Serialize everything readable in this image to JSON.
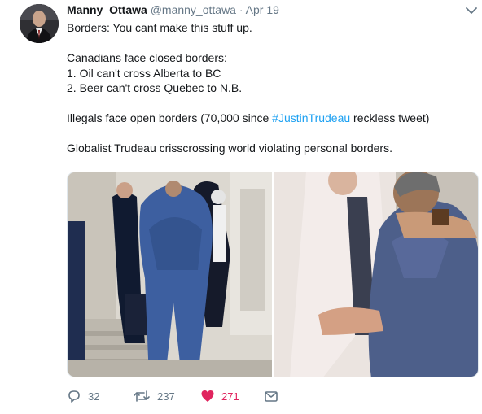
{
  "tweet": {
    "display_name": "Manny_Ottawa",
    "handle": "@manny_ottawa",
    "separator": "·",
    "date": "Apr 19",
    "lines": {
      "l1": "Borders: You cant make this stuff up.",
      "l2": "Canadians face closed borders:",
      "l3": "1. Oil can't cross Alberta to BC",
      "l4": "2. Beer can't cross Quebec to N.B.",
      "l5_pre": "Illegals face open borders (70,000 since ",
      "l5_hashtag": "#JustinTrudeau",
      "l5_post": " reckless tweet)",
      "l6": "Globalist Trudeau crisscrossing world  violating personal borders."
    }
  },
  "actions": {
    "replies": "32",
    "retweets": "237",
    "likes": "271"
  },
  "icons": {
    "reply": "reply-icon",
    "retweet": "retweet-icon",
    "like": "heart-icon",
    "dm": "envelope-icon",
    "menu": "chevron-down-icon"
  },
  "colors": {
    "hashtag": "#1da1f2",
    "like": "#e0245e",
    "muted": "#657786"
  }
}
